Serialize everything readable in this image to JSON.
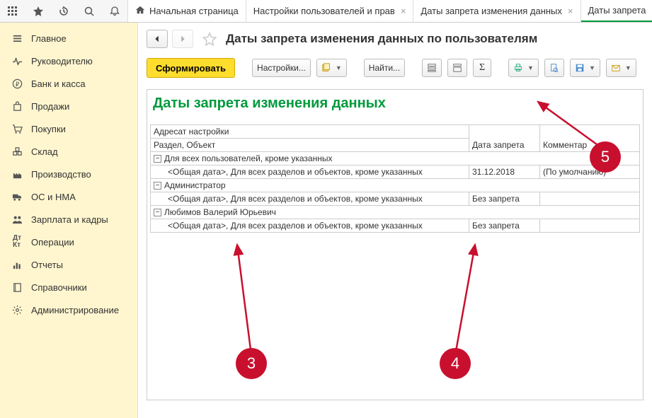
{
  "tabs": {
    "home": "Начальная страница",
    "t1": "Настройки пользователей и прав",
    "t2": "Даты запрета изменения данных",
    "t3": "Даты запрета"
  },
  "sidebar": [
    "Главное",
    "Руководителю",
    "Банк и касса",
    "Продажи",
    "Покупки",
    "Склад",
    "Производство",
    "ОС и НМА",
    "Зарплата и кадры",
    "Операции",
    "Отчеты",
    "Справочники",
    "Администрирование"
  ],
  "page": {
    "title": "Даты запрета изменения данных по пользователям",
    "btn_generate": "Сформировать",
    "btn_settings": "Настройки...",
    "btn_find": "Найти..."
  },
  "report": {
    "title": "Даты запрета изменения данных",
    "head_addr": "Адресат настройки",
    "head_section": "Раздел, Объект",
    "head_date": "Дата запрета",
    "head_comment": "Комментар",
    "rows": {
      "r1": "Для всех пользователей, кроме указанных",
      "r1c": "<Общая дата>, Для всех разделов и объектов, кроме указанных",
      "r1d": "31.12.2018",
      "r1cm": "(По умолчанию)",
      "r2": "Администратор",
      "r2c": "<Общая дата>, Для всех разделов и объектов, кроме указанных",
      "r2d": "Без запрета",
      "r3": "Любимов Валерий Юрьевич",
      "r3c": "<Общая дата>, Для всех разделов и объектов, кроме указанных",
      "r3d": "Без запрета"
    }
  },
  "callouts": {
    "c3": "3",
    "c4": "4",
    "c5": "5"
  }
}
